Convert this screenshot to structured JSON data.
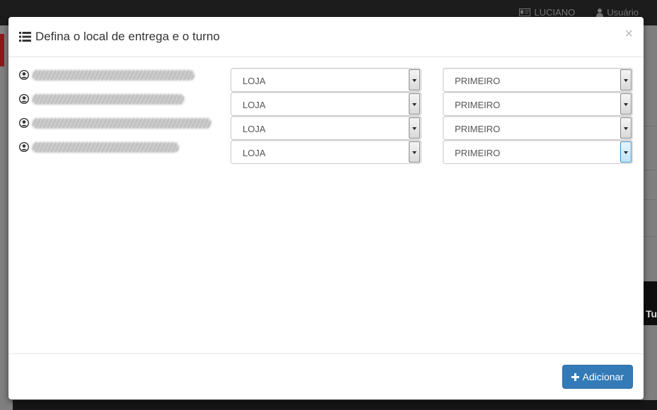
{
  "background": {
    "user_label": "LUCIANO",
    "account_label": "Usuário",
    "partial_text": "Tur"
  },
  "modal": {
    "title": "Defina o local de entrega e o turno",
    "close_glyph": "×",
    "rows": [
      {
        "local": "LOJA",
        "turno": "PRIMEIRO"
      },
      {
        "local": "LOJA",
        "turno": "PRIMEIRO"
      },
      {
        "local": "LOJA",
        "turno": "PRIMEIRO"
      },
      {
        "local": "LOJA",
        "turno": "PRIMEIRO"
      }
    ],
    "add_button_label": "Adicionar"
  },
  "colors": {
    "primary": "#337ab7",
    "overlay": "#7f7f7f"
  },
  "icons": {
    "title": "list-icon",
    "person": "user-circle-icon",
    "add": "plus-icon"
  }
}
